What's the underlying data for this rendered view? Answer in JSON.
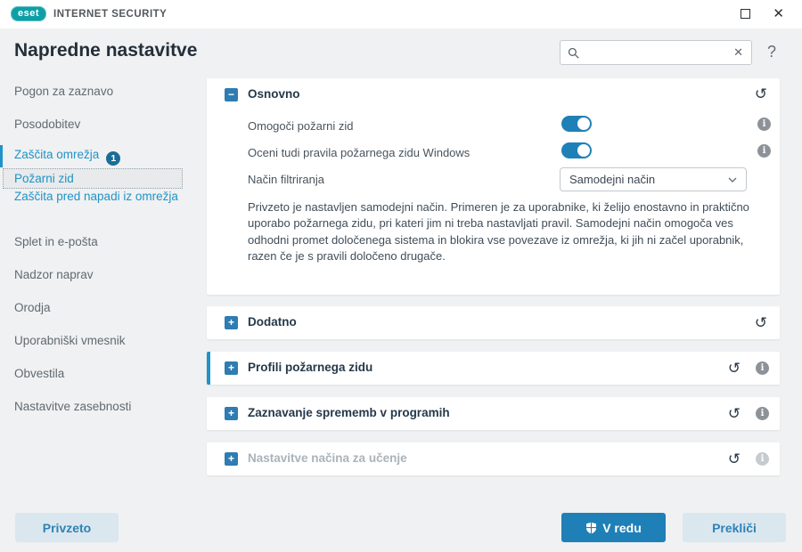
{
  "titlebar": {
    "brand": "eset",
    "product": "INTERNET SECURITY"
  },
  "header": {
    "title": "Napredne nastavitve",
    "help_glyph": "?",
    "search": {
      "value": ""
    }
  },
  "icons": {
    "plus": "+",
    "minus": "−",
    "undo": "↺",
    "info": "i",
    "clear": "✕",
    "close": "✕"
  },
  "sidebar": {
    "items": [
      {
        "label": "Pogon za zaznavo",
        "state": "normal"
      },
      {
        "label": "Posodobitev",
        "state": "normal"
      },
      {
        "label": "Zaščita omrežja",
        "state": "active",
        "badge": "1"
      },
      {
        "label": "Požarni zid",
        "state": "selected"
      },
      {
        "label": "Zaščita pred napadi iz omrežja",
        "state": "active"
      },
      {
        "label": "Splet in e-pošta",
        "state": "normal"
      },
      {
        "label": "Nadzor naprav",
        "state": "normal"
      },
      {
        "label": "Orodja",
        "state": "normal"
      },
      {
        "label": "Uporabniški vmesnik",
        "state": "normal"
      },
      {
        "label": "Obvestila",
        "state": "normal"
      },
      {
        "label": "Nastavitve zasebnosti",
        "state": "normal"
      }
    ]
  },
  "main": {
    "osnovno": {
      "title": "Osnovno",
      "expanded": true,
      "rows": [
        {
          "label": "Omogoči požarni zid",
          "control": "toggle",
          "value": true
        },
        {
          "label": "Oceni tudi pravila požarnega zidu Windows",
          "control": "toggle",
          "value": true
        },
        {
          "label": "Način filtriranja",
          "control": "select",
          "value": "Samodejni način"
        }
      ],
      "description": "Privzeto je nastavljen samodejni način. Primeren je za uporabnike, ki želijo enostavno in praktično uporabo požarnega zidu, pri kateri jim ni treba nastavljati pravil. Samodejni način omogoča ves odhodni promet določenega sistema in blokira vse povezave iz omrežja, ki jih ni začel uporabnik, razen če je s pravili določeno drugače."
    },
    "sections": [
      {
        "title": "Dodatno",
        "expanded": false
      },
      {
        "title": "Profili požarnega zidu",
        "expanded": false,
        "highlighted": true
      },
      {
        "title": "Zaznavanje sprememb v programih",
        "expanded": false
      },
      {
        "title": "Nastavitve načina za učenje",
        "expanded": false,
        "disabled": true
      }
    ]
  },
  "footer": {
    "default_label": "Privzeto",
    "ok_label": "V redu",
    "cancel_label": "Prekliči"
  },
  "colors": {
    "accent": "#2093c8",
    "toggle_on": "#1f80b7",
    "brand_teal": "#0d9fa6",
    "primary_button": "#1f80b7",
    "badge": "#1b6d96"
  }
}
